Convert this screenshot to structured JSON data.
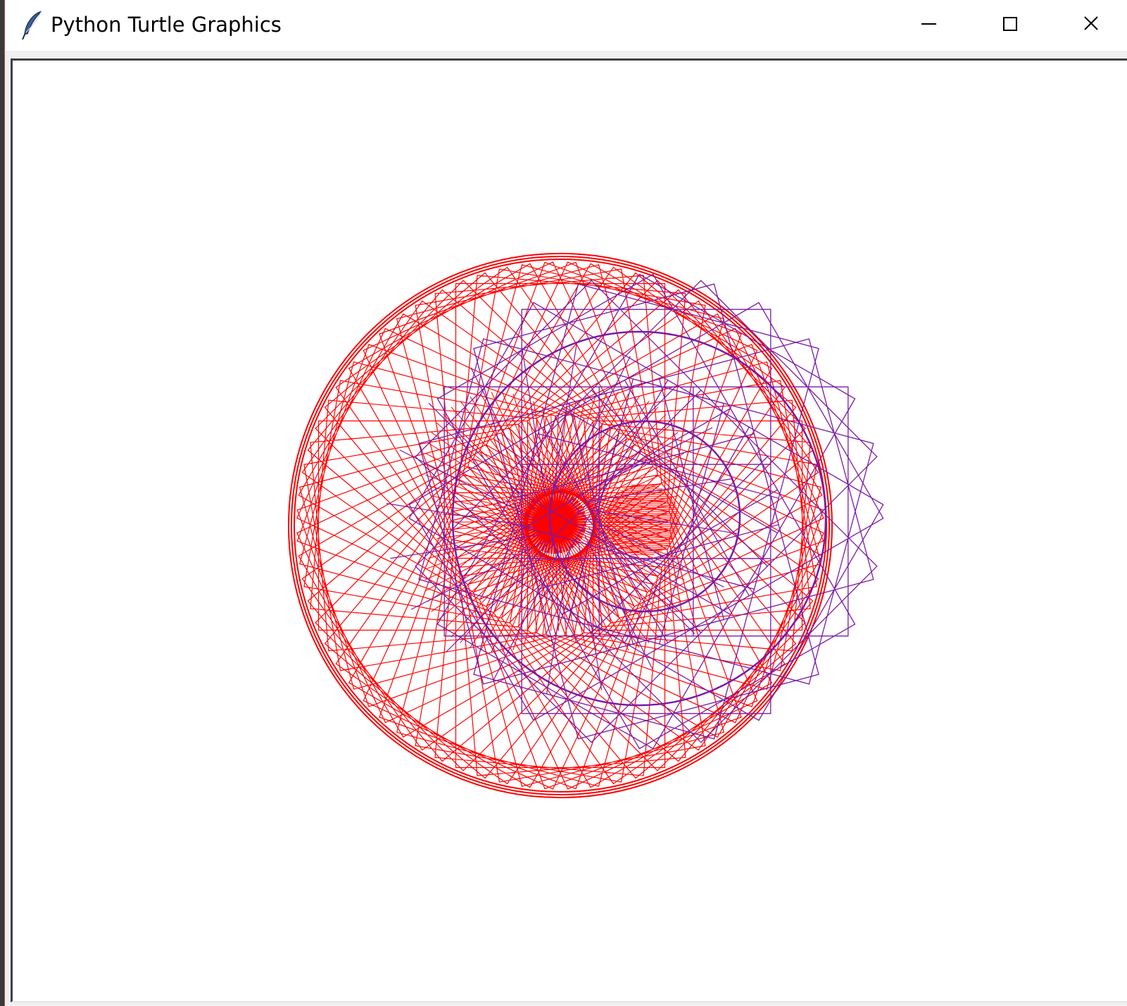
{
  "window": {
    "title": "Python Turtle Graphics",
    "icon": "feather-icon",
    "controls": [
      "minimize-icon",
      "maximize-icon",
      "close-icon"
    ]
  },
  "canvas": {
    "background": "#ffffff",
    "pen_colors": {
      "outer_pattern": "#ff0000",
      "inner_pattern": "#7a1aa6"
    }
  }
}
